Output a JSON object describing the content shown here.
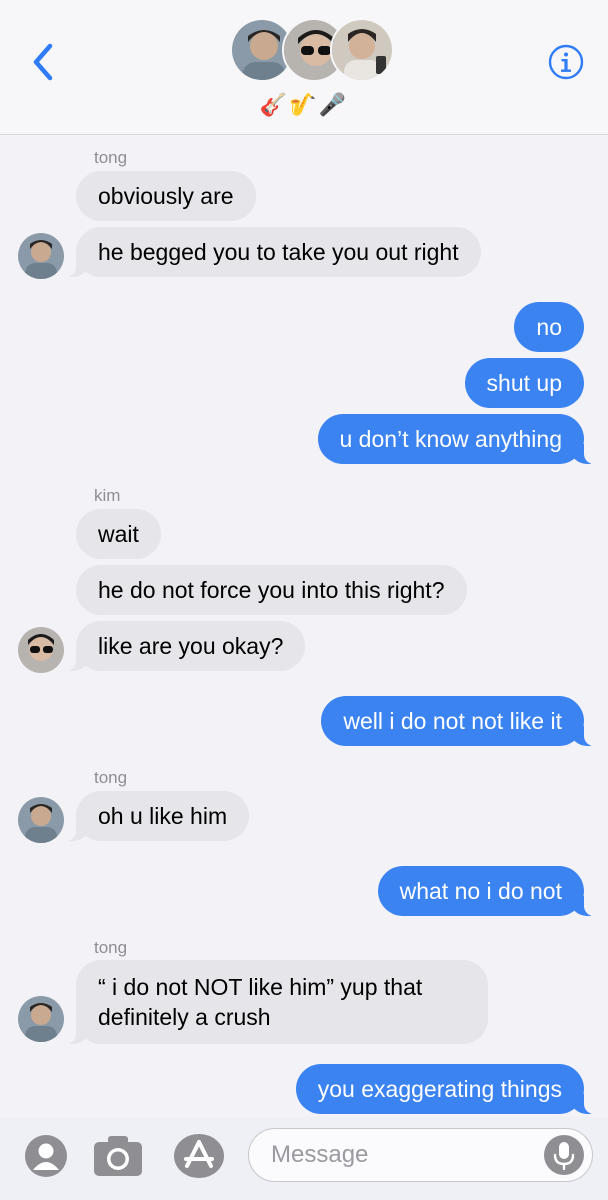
{
  "header": {
    "back_icon": "chevron-left-icon",
    "info_icon": "info-icon",
    "group_name": "🎸🎷🎤",
    "accent": "#2f7cf6"
  },
  "messages": [
    {
      "sender": "tong"
    },
    {
      "text": "obviously are",
      "from": "tong"
    },
    {
      "text": "he begged you to take you out right",
      "from": "tong"
    },
    {
      "text": "no",
      "from": "me"
    },
    {
      "text": "shut up",
      "from": "me"
    },
    {
      "text": "u don’t know anything",
      "from": "me"
    },
    {
      "sender": "kim"
    },
    {
      "text": "wait",
      "from": "kim"
    },
    {
      "text": "he do not force you into this right?",
      "from": "kim"
    },
    {
      "text": "like are you okay?",
      "from": "kim"
    },
    {
      "text": "well i do not not like it",
      "from": "me"
    },
    {
      "sender": "tong"
    },
    {
      "text": "oh u like him",
      "from": "tong"
    },
    {
      "text": "what no i do not",
      "from": "me"
    },
    {
      "sender": "tong"
    },
    {
      "text": "“ i do not NOT like him” yup that definitely a crush",
      "from": "tong"
    },
    {
      "text": "you exaggerating things",
      "from": "me"
    }
  ],
  "colors": {
    "incoming_bubble": "#e5e5ea",
    "outgoing_bubble": "#3a83f1",
    "background": "#f2f2f7"
  },
  "compose": {
    "placeholder": "Message",
    "icons": [
      "contact-icon",
      "camera-icon",
      "app-store-icon",
      "mic-icon"
    ]
  }
}
